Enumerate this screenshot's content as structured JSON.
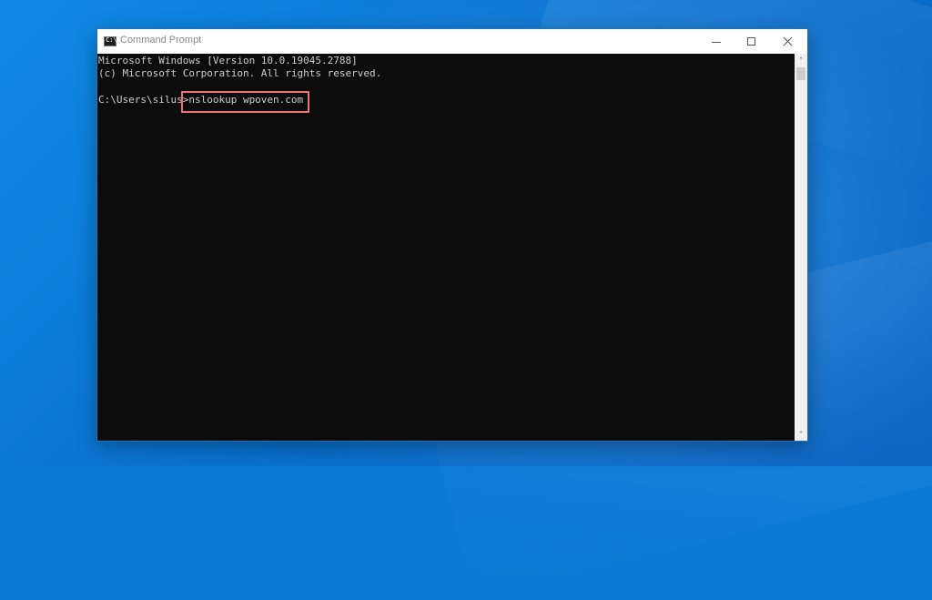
{
  "window": {
    "title": "Command Prompt",
    "icon": "cmd-icon",
    "icon_glyph": "C:\\_"
  },
  "controls": {
    "minimize_icon": "minimize-icon",
    "maximize_icon": "maximize-icon",
    "close_icon": "close-icon"
  },
  "console": {
    "lines": [
      "Microsoft Windows [Version 10.0.19045.2788]",
      "(c) Microsoft Corporation. All rights reserved.",
      "C:\\Users\\silus>nslookup wpoven.com"
    ],
    "highlighted_command": "nslookup wpoven.com"
  },
  "scrollbar": {
    "up_arrow": "˄",
    "down_arrow": "˅"
  },
  "colors": {
    "console_bg": "#0c0c0c",
    "console_fg": "#cccccc",
    "highlight_border": "#e9727a",
    "desktop_blue": "#0a7ad6"
  }
}
